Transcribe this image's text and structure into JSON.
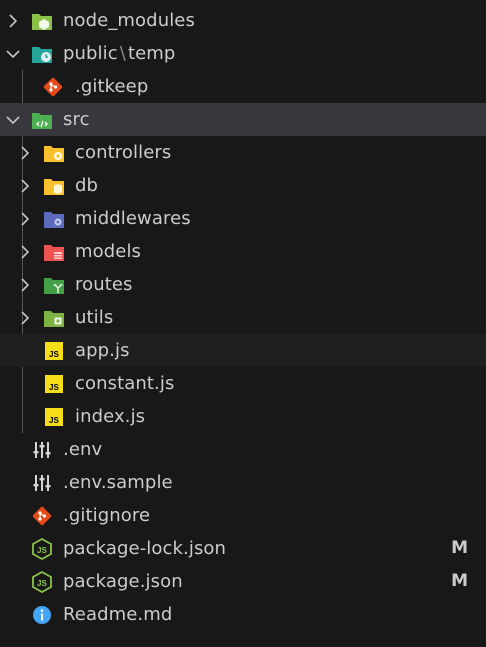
{
  "explorer": {
    "items": [
      {
        "label": "node_modules",
        "icon": "folder-node-icon"
      },
      {
        "label": "public",
        "label_sep": "\\",
        "label_tail": "temp",
        "icon": "folder-clock-icon"
      },
      {
        "label": ".gitkeep",
        "icon": "git-icon"
      },
      {
        "label": "src",
        "icon": "folder-src-icon"
      },
      {
        "label": "controllers",
        "icon": "folder-controller-icon"
      },
      {
        "label": "db",
        "icon": "folder-database-icon"
      },
      {
        "label": "middlewares",
        "icon": "folder-middleware-icon"
      },
      {
        "label": "models",
        "icon": "folder-models-icon"
      },
      {
        "label": "routes",
        "icon": "folder-routes-icon"
      },
      {
        "label": "utils",
        "icon": "folder-utils-icon"
      },
      {
        "label": "app.js",
        "icon": "js-icon"
      },
      {
        "label": "constant.js",
        "icon": "js-icon"
      },
      {
        "label": "index.js",
        "icon": "js-icon"
      },
      {
        "label": ".env",
        "icon": "env-tune-icon"
      },
      {
        "label": ".env.sample",
        "icon": "env-tune-icon"
      },
      {
        "label": ".gitignore",
        "icon": "git-icon"
      },
      {
        "label": "package-lock.json",
        "icon": "nodejs-icon",
        "badge": "M"
      },
      {
        "label": "package.json",
        "icon": "nodejs-icon",
        "badge": "M"
      },
      {
        "label": "Readme.md",
        "icon": "info-icon"
      }
    ]
  },
  "colors": {
    "background": "#181818",
    "selected_row": "#37373d",
    "text": "#cccccc",
    "folder_green": "#8bc34a",
    "folder_teal": "#26a69a",
    "folder_yellow": "#fbc02d",
    "folder_purple": "#5c6bc0",
    "folder_red": "#ef5350",
    "git_orange": "#e64a19",
    "js_yellow": "#f5de19",
    "env_text": "#cccccc",
    "nodejs_green": "#8bc34a",
    "info_blue": "#42a5f5"
  }
}
